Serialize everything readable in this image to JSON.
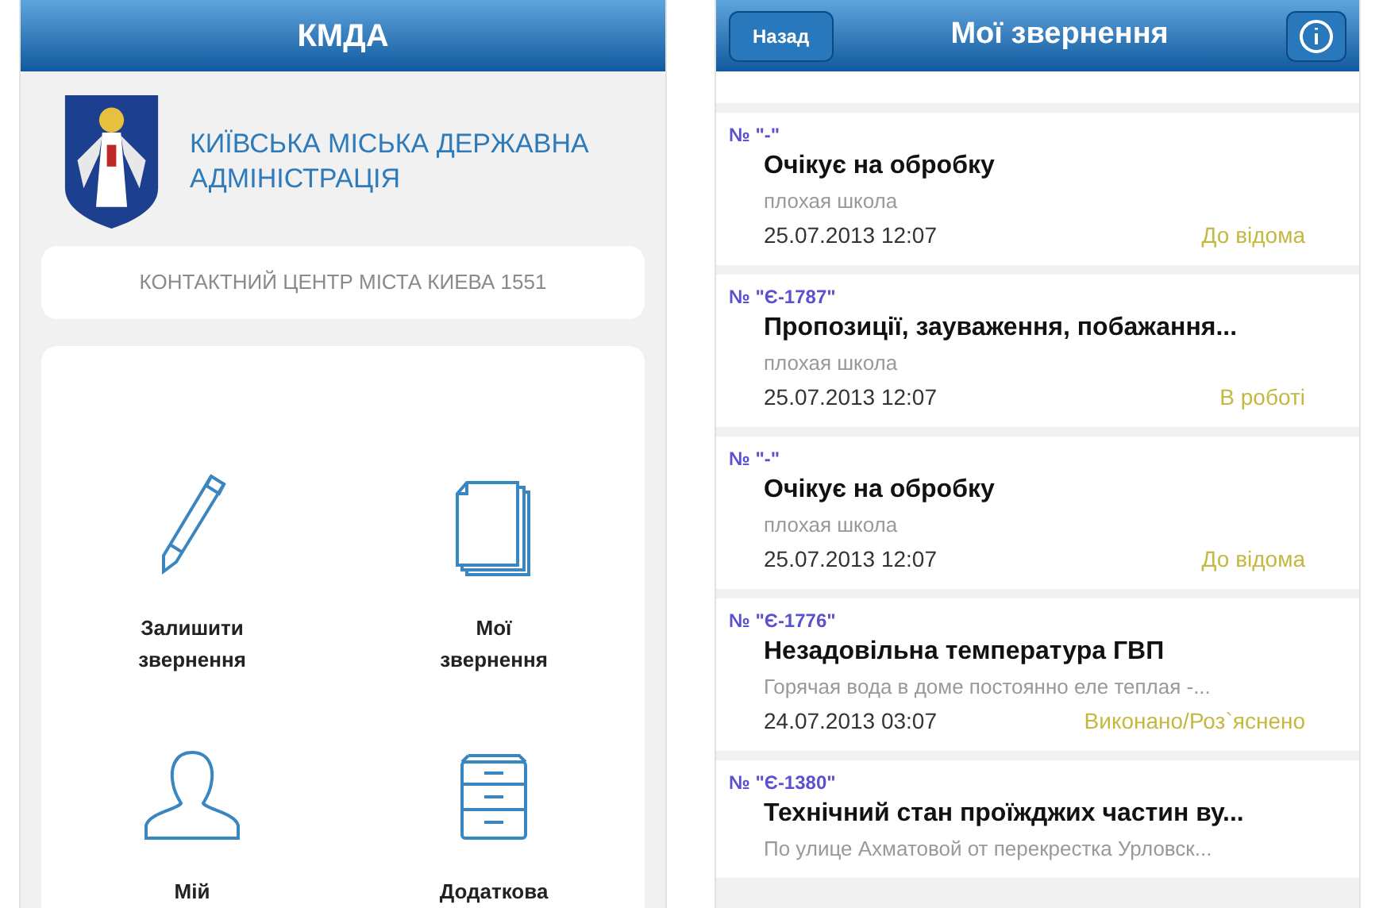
{
  "home_screen": {
    "title": "КМДА",
    "org_name": "КИЇВСЬКА МІСЬКА ДЕРЖАВНА АДМІНІСТРАЦІЯ",
    "contact_center": "КОНТАКТНИЙ ЦЕНТР МІСТА КИЕВА 1551",
    "menu": [
      {
        "kind": "pencil",
        "label": "Залишити звернення"
      },
      {
        "kind": "documents",
        "label": "Мої звернення"
      },
      {
        "kind": "person",
        "label": "Мій"
      },
      {
        "kind": "cabinet",
        "label": "Додаткова"
      }
    ]
  },
  "requests_screen": {
    "back": "Назад",
    "title": "Мої звернення",
    "items": [
      {
        "number": "№ \"-\"",
        "title": "Очікує на обробку",
        "description": "плохая школа",
        "date": "25.07.2013 12:07",
        "status": "До відома"
      },
      {
        "number": "№ \"Є-1787\"",
        "title": "Пропозиції, зауваження, побажання...",
        "description": "плохая школа",
        "date": "25.07.2013 12:07",
        "status": "В роботі"
      },
      {
        "number": "№ \"-\"",
        "title": "Очікує на обробку",
        "description": "плохая школа",
        "date": "25.07.2013 12:07",
        "status": "До відома"
      },
      {
        "number": "№ \"Є-1776\"",
        "title": "Незадовільна температура ГВП",
        "description": "Горячая вода в доме постоянно еле теплая -...",
        "date": "24.07.2013 03:07",
        "status": "Виконано/Роз`яснено"
      },
      {
        "number": "№ \"Є-1380\"",
        "title": "Технічний стан проїжджих частин ву...",
        "description": "По улице Ахматовой от перекрестка Урловск..."
      }
    ]
  }
}
